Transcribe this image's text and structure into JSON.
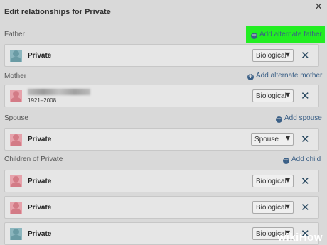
{
  "dialog": {
    "title": "Edit relationships for Private",
    "close_icon": "×"
  },
  "sections": {
    "father": {
      "label": "Father",
      "add": "Add alternate father"
    },
    "mother": {
      "label": "Mother",
      "add": "Add alternate mother"
    },
    "spouse": {
      "label": "Spouse",
      "add": "Add spouse"
    },
    "children": {
      "label": "Children of Private",
      "add": "Add child"
    }
  },
  "people": {
    "father": {
      "name": "Private",
      "relation": "Biological",
      "gender": "male"
    },
    "mother": {
      "name": "",
      "dates": "1921–2008",
      "relation": "Biological",
      "gender": "female"
    },
    "spouse": {
      "name": "Private",
      "relation": "Spouse",
      "gender": "female"
    },
    "child1": {
      "name": "Private",
      "relation": "Biological",
      "gender": "female"
    },
    "child2": {
      "name": "Private",
      "relation": "Biological",
      "gender": "female"
    },
    "child3": {
      "name": "Private",
      "relation": "Biological",
      "gender": "male"
    }
  },
  "icons": {
    "remove": "✕",
    "caret": "▼",
    "plus": "+"
  },
  "watermark": "wikiHow",
  "colors": {
    "highlight": "#22ee22",
    "link": "#3a5f86",
    "remove": "#27475f"
  }
}
